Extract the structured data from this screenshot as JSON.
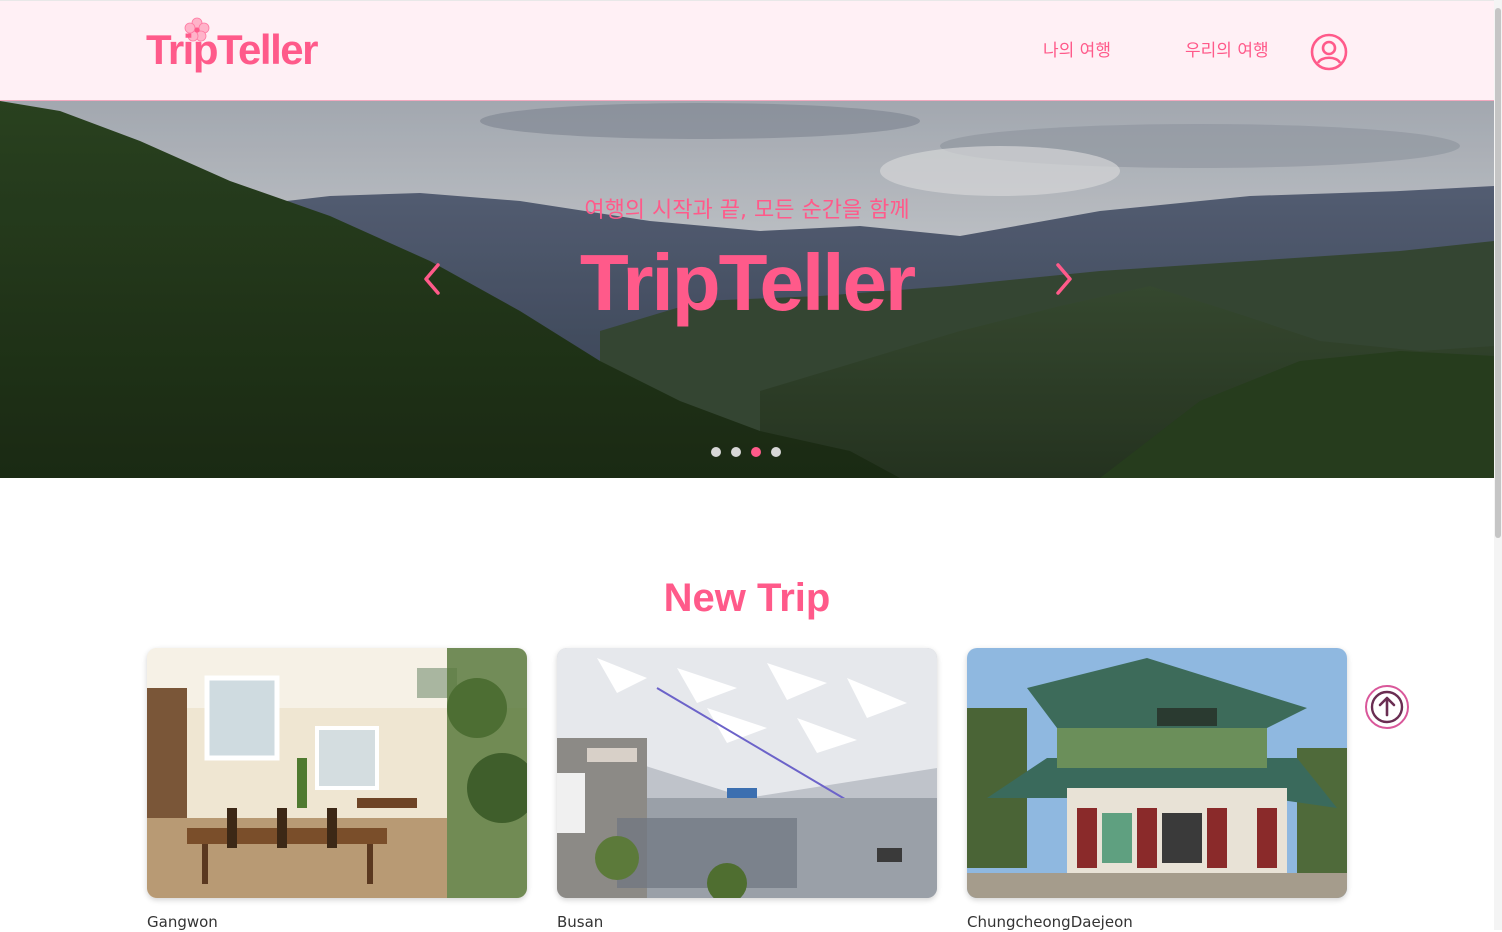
{
  "header": {
    "logo": "TripTeller",
    "nav": [
      {
        "label": "나의 여행"
      },
      {
        "label": "우리의 여행"
      }
    ],
    "profile_icon": "user-circle-icon"
  },
  "hero": {
    "subtitle": "여행의 시작과 끝, 모든 순간을 함께",
    "title": "TripTeller",
    "slides": 4,
    "active_slide": 3
  },
  "section": {
    "title": "New Trip",
    "cards": [
      {
        "name": "Gangwon"
      },
      {
        "name": "Busan"
      },
      {
        "name": "ChungcheongDaejeon"
      }
    ]
  },
  "colors": {
    "accent": "#ff5a8a",
    "header_bg": "#fff0f5"
  },
  "icons": {
    "prev": "chevron-left-icon",
    "next": "chevron-right-icon",
    "top": "arrow-up-circle-icon"
  }
}
